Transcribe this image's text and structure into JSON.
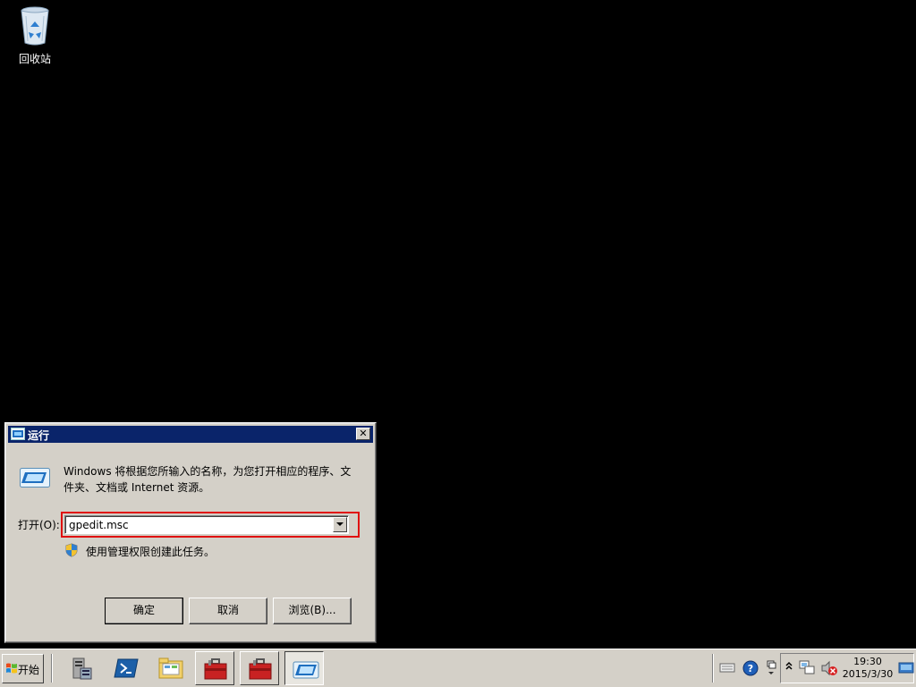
{
  "desktop": {
    "icons": [
      {
        "label": "回收站"
      }
    ]
  },
  "run_dialog": {
    "title": "运行",
    "close_glyph": "✕",
    "description": "Windows 将根据您所输入的名称，为您打开相应的程序、文件夹、文档或 Internet 资源。",
    "open_label": "打开(O):",
    "open_value": "gpedit.msc",
    "admin_note": "使用管理权限创建此任务。",
    "buttons": {
      "ok": "确定",
      "cancel": "取消",
      "browse": "浏览(B)..."
    },
    "highlight_color": "#e01010"
  },
  "taskbar": {
    "start_label": "开始",
    "pinned": [
      {
        "icon": "server-manager-icon"
      },
      {
        "icon": "powershell-icon"
      },
      {
        "icon": "explorer-folder-icon"
      },
      {
        "icon": "toolbox-icon"
      },
      {
        "icon": "toolbox-icon"
      },
      {
        "icon": "run-window-icon",
        "active": true
      }
    ],
    "tray": {
      "icons": [
        "keyboard-icon",
        "help-icon",
        "language-bar-icon",
        "show-hidden-icons-icon",
        "network-icon",
        "volume-muted-icon"
      ],
      "time": "19:30",
      "date": "2015/3/30"
    }
  }
}
